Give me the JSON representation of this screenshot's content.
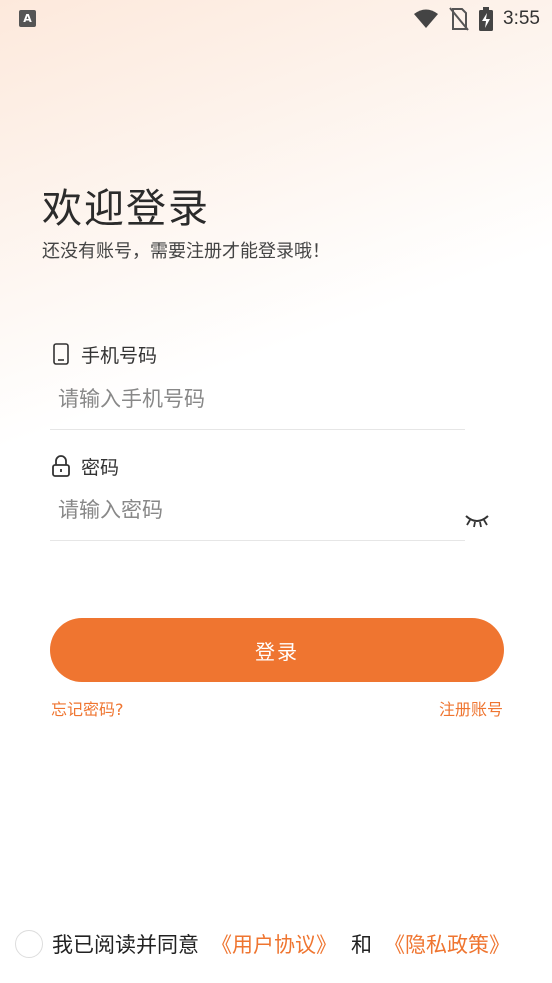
{
  "status_bar": {
    "app_icon_glyph": "A",
    "time": "3:55",
    "icons": [
      "wifi-icon",
      "no-sim-icon",
      "battery-charging-icon"
    ]
  },
  "header": {
    "title": "欢迎登录",
    "subtitle": "还没有账号，需要注册才能登录哦！"
  },
  "form": {
    "phone": {
      "label": "手机号码",
      "icon": "phone-icon",
      "placeholder": "请输入手机号码",
      "value": ""
    },
    "password": {
      "label": "密码",
      "icon": "lock-icon",
      "placeholder": "请输入密码",
      "value": "",
      "toggle_icon": "eye-closed-icon"
    },
    "login_label": "登录",
    "forgot_label": "忘记密码?",
    "register_label": "注册账号"
  },
  "agreement": {
    "checked": false,
    "prefix": "我已阅读并同意",
    "user_agreement": "《用户协议》",
    "and": "和",
    "privacy_policy": "《隐私政策》"
  },
  "colors": {
    "accent": "#ef7530",
    "text_dark": "#222222",
    "placeholder": "#888888"
  }
}
